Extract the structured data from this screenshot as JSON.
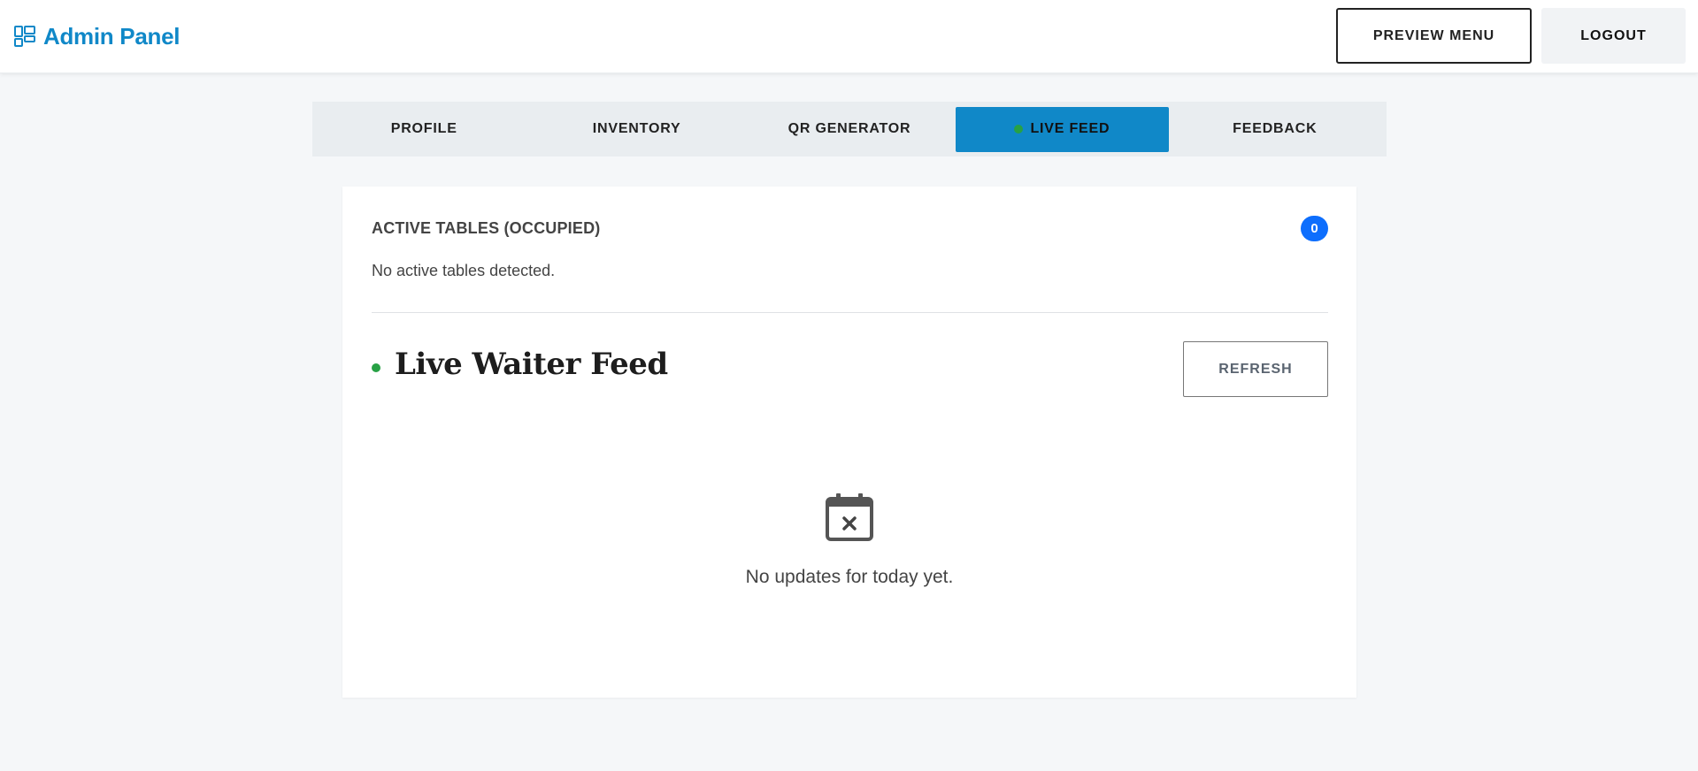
{
  "header": {
    "brand_icon": "dashboard-icon",
    "brand_name": "Admin Panel",
    "preview_label": "PREVIEW MENU",
    "logout_label": "LOGOUT"
  },
  "tabs": [
    {
      "label": "PROFILE",
      "active": false
    },
    {
      "label": "INVENTORY",
      "active": false
    },
    {
      "label": "QR GENERATOR",
      "active": false
    },
    {
      "label": "LIVE FEED",
      "active": true
    },
    {
      "label": "FEEDBACK",
      "active": false
    }
  ],
  "active_tables": {
    "title": "ACTIVE TABLES (OCCUPIED)",
    "count": "0",
    "empty_message": "No active tables detected."
  },
  "live_feed": {
    "title": "Live Waiter Feed",
    "refresh_label": "REFRESH",
    "empty_icon": "calendar-x-icon",
    "empty_message": "No updates for today yet."
  },
  "colors": {
    "brand": "#1088c8",
    "active_tab": "#1088c8",
    "badge": "#0d6efd",
    "live_dot": "#27a145",
    "page_bg": "#f5f7f9"
  }
}
